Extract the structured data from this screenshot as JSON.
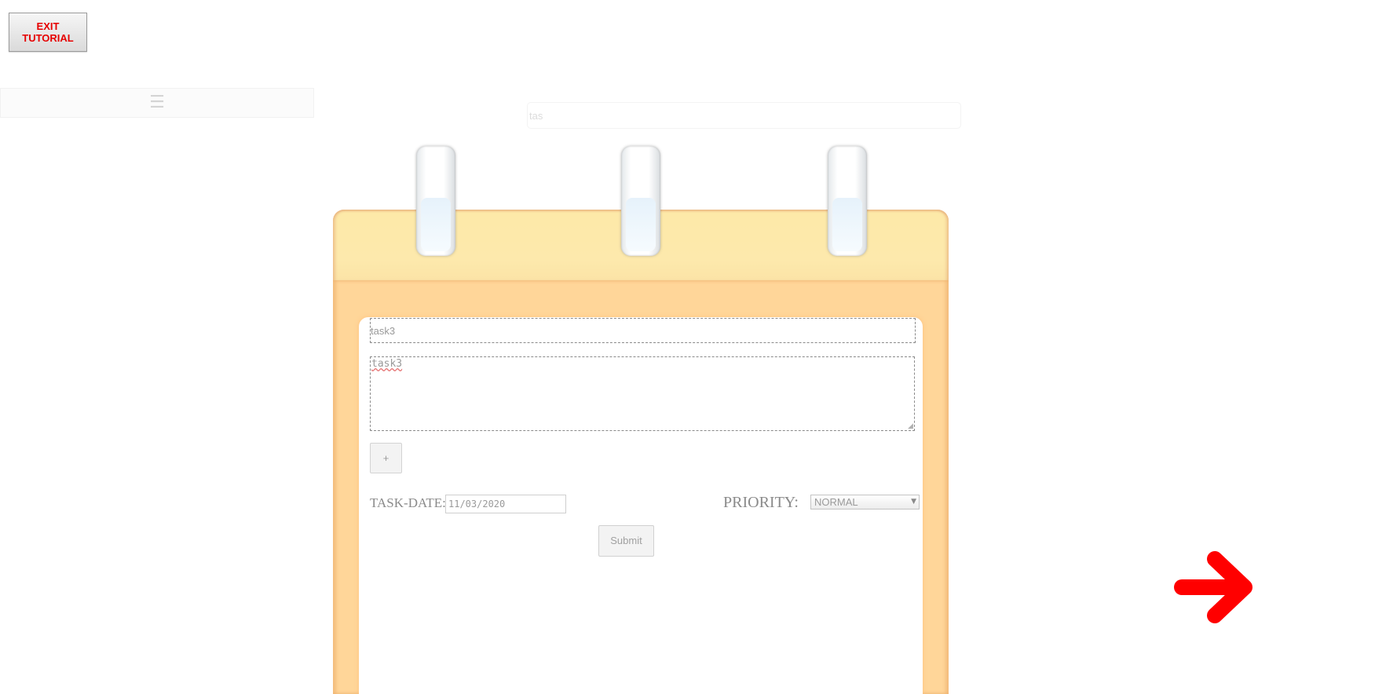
{
  "tutorial": {
    "exit_label_line1": "EXIT",
    "exit_label_line2": "TUTORIAL"
  },
  "menu": {
    "icon": "hamburger-icon",
    "glyph": "☰"
  },
  "search": {
    "placeholder": "tas"
  },
  "task_form": {
    "title_value": "task3",
    "description_value": "task3",
    "add_label": "+",
    "date_label": "TASK-DATE:",
    "date_value": "11/03/2020",
    "priority_label": "PRIORITY:",
    "priority_selected": "NORMAL",
    "submit_label": "Submit"
  },
  "navigation": {
    "next_icon": "arrow-right-icon"
  },
  "colors": {
    "accent_red": "#ff0000",
    "notepad_header": "#fde9a8",
    "notepad_body": "#ffd699"
  }
}
